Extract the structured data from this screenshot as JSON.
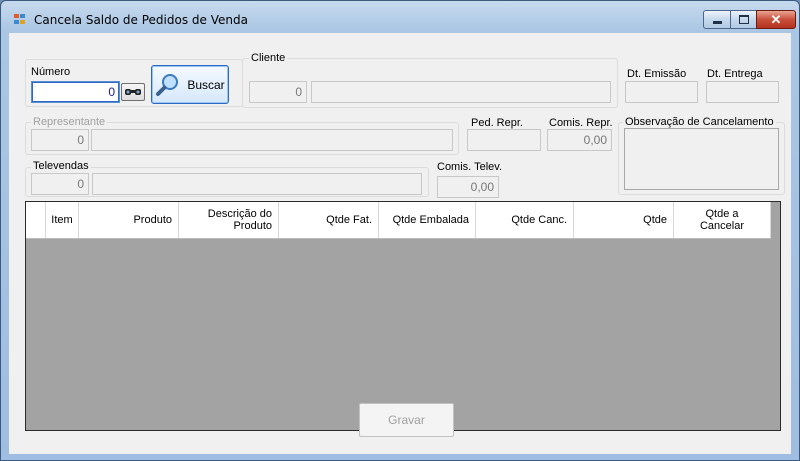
{
  "window": {
    "title": "Cancela Saldo de Pedidos de Venda",
    "close_glyph": "✕",
    "min_glyph": "▁",
    "max_glyph": "▢"
  },
  "numero": {
    "label": "Número",
    "value": "0"
  },
  "buscar": {
    "label": "Buscar"
  },
  "cliente": {
    "label": "Cliente",
    "code": "0",
    "name": ""
  },
  "dt_emissao": {
    "label": "Dt. Emissão",
    "value": ""
  },
  "dt_entrega": {
    "label": "Dt. Entrega",
    "value": ""
  },
  "representante": {
    "label": "Representante",
    "code": "0",
    "name": ""
  },
  "ped_repr": {
    "label": "Ped. Repr.",
    "value": ""
  },
  "comis_repr": {
    "label": "Comis. Repr.",
    "value": "0,00"
  },
  "observacao": {
    "label": "Observação de Cancelamento",
    "value": ""
  },
  "televendas": {
    "label": "Televendas",
    "code": "0",
    "name": ""
  },
  "comis_telev": {
    "label": "Comis. Telev.",
    "value": "0,00"
  },
  "grid": {
    "columns": [
      "Item",
      "Produto",
      "Descrição do Produto",
      "Qtde Fat.",
      "Qtde Embalada",
      "Qtde Canc.",
      "Qtde",
      "Qtde a Cancelar"
    ]
  },
  "gravar": {
    "label": "Gravar"
  },
  "colors": {
    "accent": "#2a6ac4",
    "grid_bg": "#a3a3a3",
    "form_bg": "#f0f0f0"
  },
  "icons": {
    "app": "form-icon",
    "search": "magnifier-icon",
    "lookup": "binoculars-icon"
  }
}
